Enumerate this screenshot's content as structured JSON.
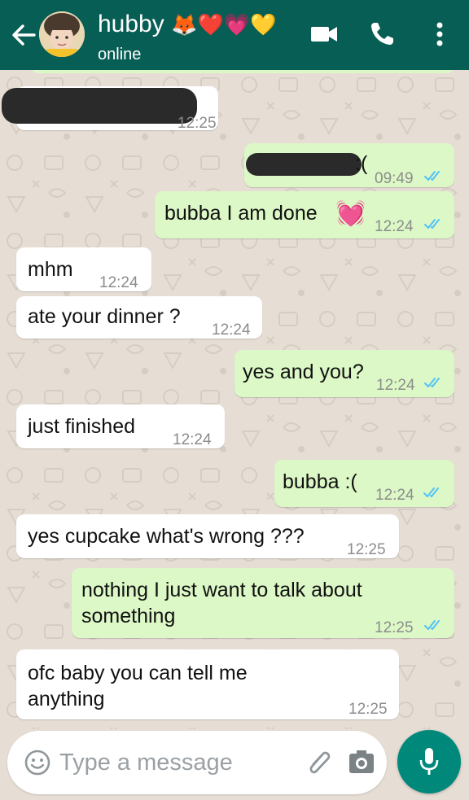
{
  "header": {
    "back_icon": "arrow-left-icon",
    "contact_name": "hubby",
    "contact_emojis": "🦊❤️💗💛",
    "status": "online",
    "icons": [
      "videocam-icon",
      "phone-icon",
      "more-vert-icon"
    ]
  },
  "messages": [
    {
      "dir": "in",
      "text": "",
      "time": "12:25",
      "redacted": true
    },
    {
      "dir": "out",
      "text": ":(",
      "time": "09:49",
      "read": true,
      "redacted": true
    },
    {
      "dir": "out",
      "text": "bubba I am done",
      "emoji": "💓",
      "time": "12:24",
      "read": true
    },
    {
      "dir": "in",
      "text": "mhm",
      "time": "12:24"
    },
    {
      "dir": "in",
      "text": "ate your dinner ?",
      "time": "12:24"
    },
    {
      "dir": "out",
      "text": "yes and you?",
      "time": "12:24",
      "read": true
    },
    {
      "dir": "in",
      "text": "just finished",
      "time": "12:24"
    },
    {
      "dir": "out",
      "text": "bubba :(",
      "time": "12:24",
      "read": true
    },
    {
      "dir": "in",
      "text": "yes cupcake what's wrong ???",
      "time": "12:25"
    },
    {
      "dir": "out",
      "text": "nothing I just want to talk about",
      "text2": "something",
      "time": "12:25",
      "read": true
    },
    {
      "dir": "in",
      "text": "ofc baby you can tell me",
      "text2": "anything",
      "time": "12:25"
    }
  ],
  "composer": {
    "placeholder": "Type a message",
    "value": "",
    "icons": [
      "emoji-icon",
      "attach-icon",
      "camera-icon",
      "mic-icon"
    ]
  },
  "colors": {
    "header": "#075e54",
    "incoming_bubble": "#ffffff",
    "outgoing_bubble": "#dcf8c6",
    "wallpaper": "#e6ded5",
    "read_ticks": "#4fc3f7",
    "mic_button": "#00897b"
  }
}
